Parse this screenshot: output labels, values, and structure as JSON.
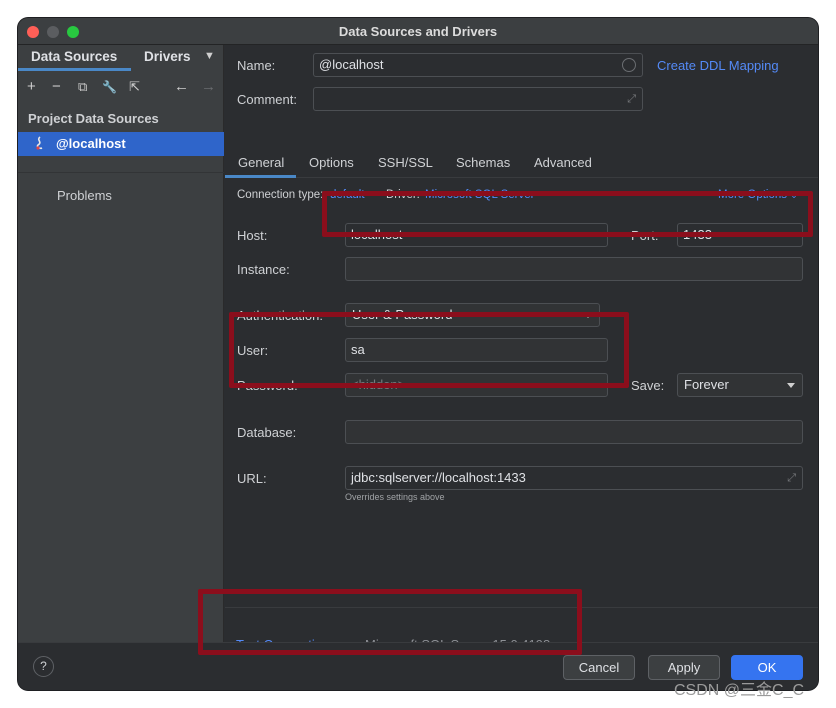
{
  "window": {
    "title": "Data Sources and Drivers"
  },
  "left_panel": {
    "tabs": [
      "Data Sources",
      "Drivers"
    ],
    "toolbar": {
      "add": "+",
      "remove": "−",
      "copy": "⧉",
      "settings": "🔧",
      "export": "⇱",
      "back": "←",
      "forward": "→"
    },
    "section_title": "Project Data Sources",
    "items": [
      {
        "label": "@localhost",
        "icon": "sql-server-icon"
      }
    ],
    "problems_label": "Problems"
  },
  "header": {
    "name_label": "Name:",
    "name_value": "@localhost",
    "comment_label": "Comment:",
    "comment_value": "",
    "ddl_link": "Create DDL Mapping"
  },
  "tabs": [
    "General",
    "Options",
    "SSH/SSL",
    "Schemas",
    "Advanced"
  ],
  "active_tab": "General",
  "connection": {
    "type_label": "Connection type:",
    "type_value": "default",
    "driver_label": "Driver:",
    "driver_value": "Microsoft SQL Server",
    "more_options": "More Options"
  },
  "form": {
    "host_label": "Host:",
    "host_value": "localhost",
    "port_label": "Port:",
    "port_value": "1433",
    "instance_label": "Instance:",
    "instance_value": "",
    "auth_label": "Authentication:",
    "auth_value": "User & Password",
    "user_label": "User:",
    "user_value": "sa",
    "password_label": "Password:",
    "password_placeholder": "<hidden>",
    "save_label": "Save:",
    "save_value": "Forever",
    "database_label": "Database:",
    "database_value": "",
    "url_label": "URL:",
    "url_value": "jdbc:sqlserver://localhost:1433",
    "url_note": "Overrides settings above"
  },
  "test": {
    "link": "Test Connection",
    "result": "Microsoft SQL Server 15.0.4198"
  },
  "footer": {
    "help": "?",
    "cancel": "Cancel",
    "apply": "Apply",
    "ok": "OK"
  },
  "watermark": "CSDN @三金C_C",
  "colors": {
    "accent": "#3574f0",
    "link": "#548af7",
    "highlight_box": "#8b0e1c",
    "selection": "#2f65ca"
  }
}
